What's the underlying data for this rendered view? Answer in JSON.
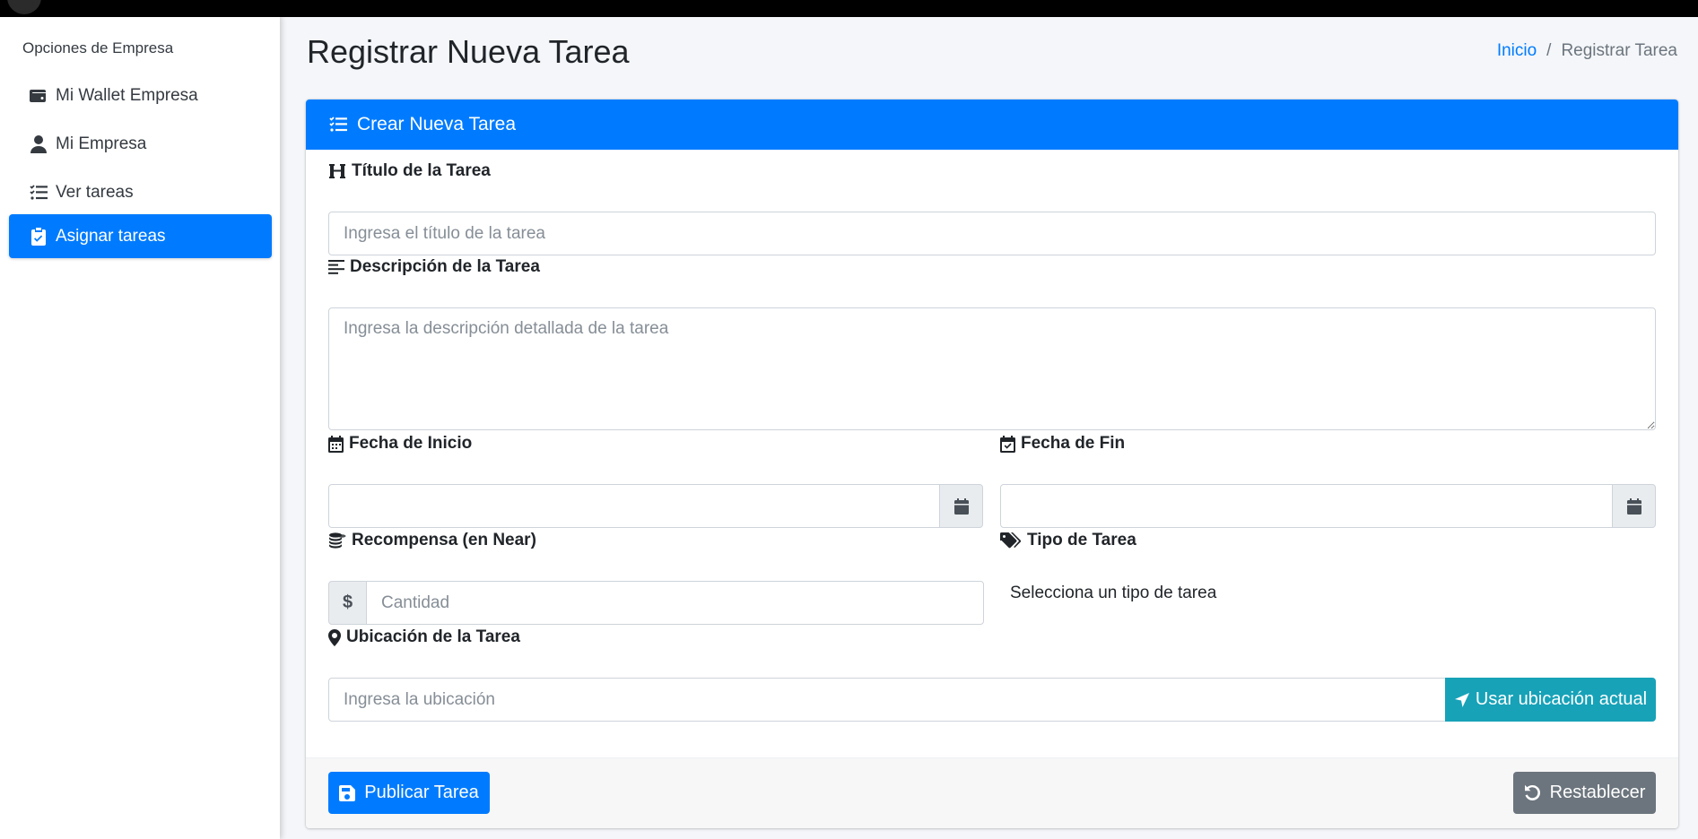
{
  "sidebar": {
    "header": "Opciones de Empresa",
    "items": [
      {
        "label": "Mi Wallet Empresa",
        "icon": "wallet-icon",
        "active": false
      },
      {
        "label": "Mi Empresa",
        "icon": "user-icon",
        "active": false
      },
      {
        "label": "Ver tareas",
        "icon": "tasks-icon",
        "active": false
      },
      {
        "label": "Asignar tareas",
        "icon": "clipboard-check-icon",
        "active": true
      }
    ]
  },
  "page": {
    "title": "Registrar Nueva Tarea",
    "breadcrumb": {
      "home": "Inicio",
      "separator": "/",
      "current": "Registrar Tarea"
    }
  },
  "card": {
    "header": "Crear Nueva Tarea"
  },
  "form": {
    "title_label": "Título de la Tarea",
    "title_placeholder": "Ingresa el título de la tarea",
    "description_label": "Descripción de la Tarea",
    "description_placeholder": "Ingresa la descripción detallada de la tarea",
    "start_label": "Fecha de Inicio",
    "end_label": "Fecha de Fin",
    "reward_label": "Recompensa (en Near)",
    "reward_prefix": "$",
    "reward_placeholder": "Cantidad",
    "type_label": "Tipo de Tarea",
    "type_value": "Selecciona un tipo de tarea",
    "location_label": "Ubicación de la Tarea",
    "location_placeholder": "Ingresa la ubicación",
    "geo_button": "Usar ubicación actual"
  },
  "footer": {
    "submit_label": "Publicar Tarea",
    "reset_label": "Restablecer"
  },
  "colors": {
    "primary": "#007bff",
    "info": "#17a2b8",
    "secondary": "#6c757d"
  }
}
